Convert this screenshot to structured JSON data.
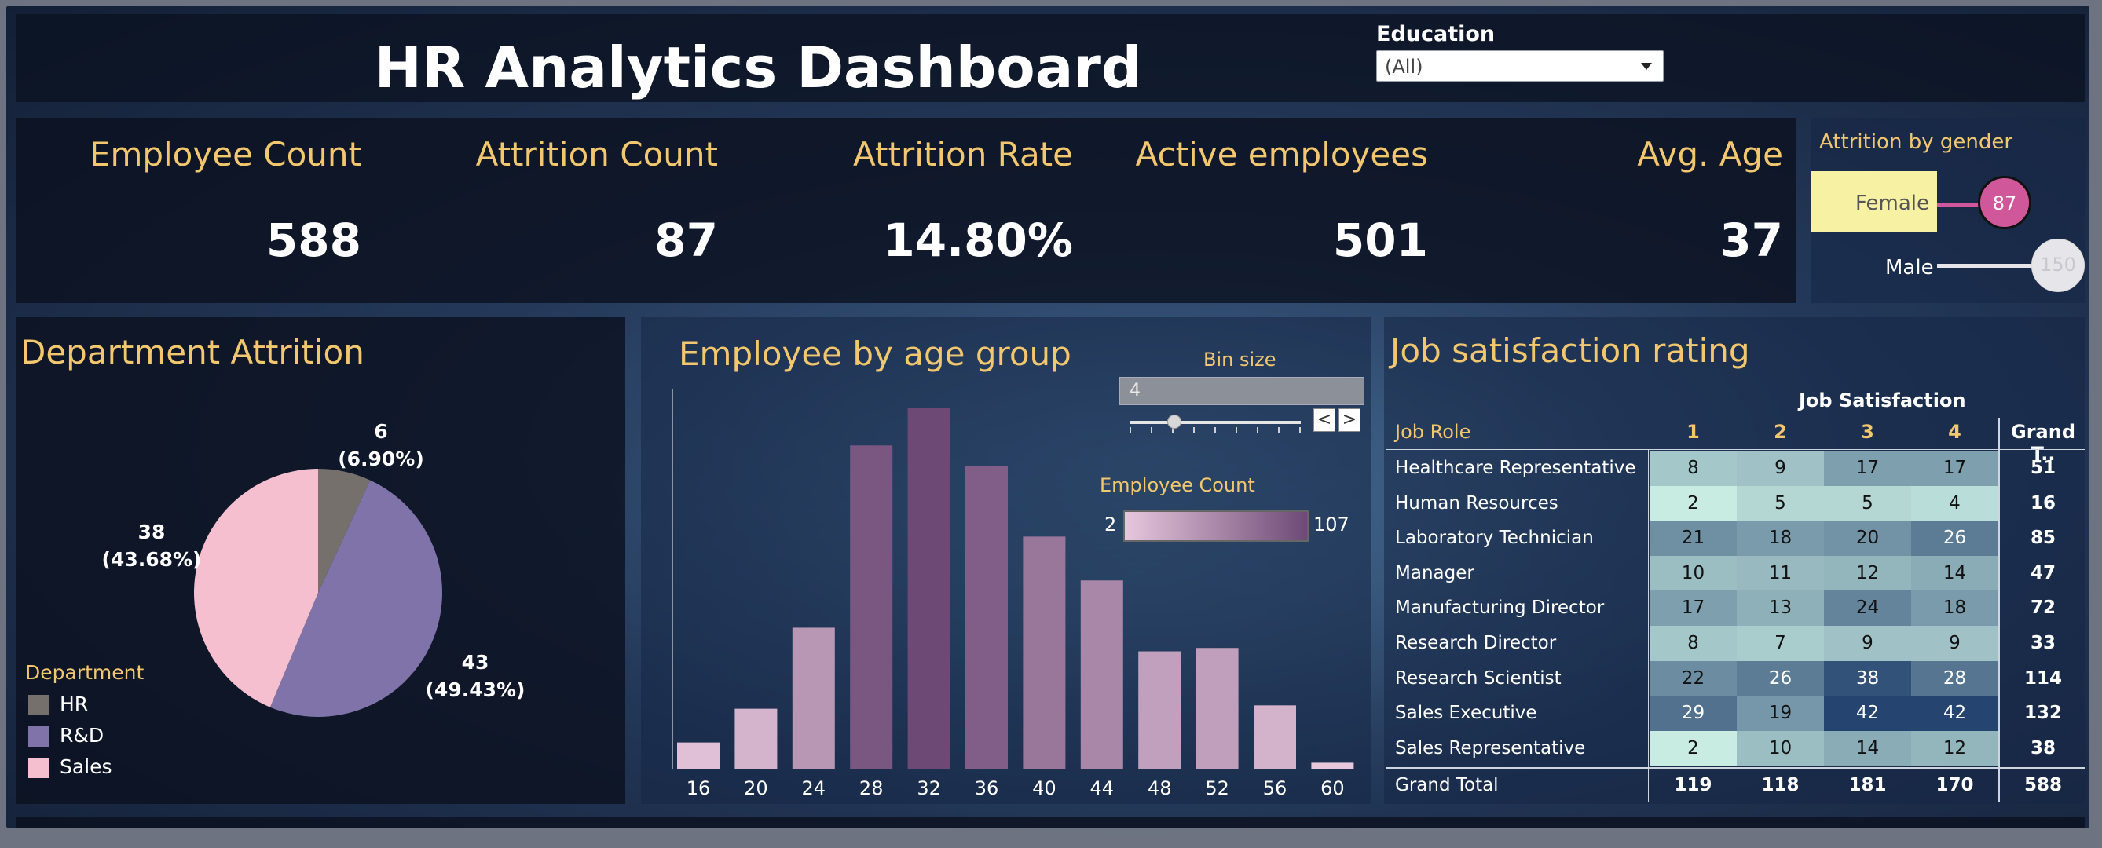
{
  "header": {
    "title": "HR Analytics Dashboard",
    "filter_label": "Education",
    "filter_value": "(All)"
  },
  "kpis": [
    {
      "label": "Employee Count",
      "value": "588"
    },
    {
      "label": "Attrition Count",
      "value": "87"
    },
    {
      "label": "Attrition Rate",
      "value": "14.80%"
    },
    {
      "label": "Active employees",
      "value": "501"
    },
    {
      "label": "Avg. Age",
      "value": "37"
    }
  ],
  "gender": {
    "title": "Attrition by gender",
    "female_label": "Female",
    "female_value": "87",
    "male_label": "Male",
    "male_value": "150",
    "female_color": "#d0589a",
    "male_color": "#e6e6ea"
  },
  "department": {
    "title": "Department Attrition",
    "legend_title": "Department",
    "legend": [
      {
        "name": "HR",
        "color": "#75706c"
      },
      {
        "name": "R&D",
        "color": "#7f73aa"
      },
      {
        "name": "Sales",
        "color": "#f5bfd0"
      }
    ],
    "labels": [
      {
        "count": "6",
        "pct": "(6.90%)"
      },
      {
        "count": "43",
        "pct": "(49.43%)"
      },
      {
        "count": "38",
        "pct": "(43.68%)"
      }
    ]
  },
  "age": {
    "title": "Employee by age group",
    "bin_label": "Bin size",
    "bin_value": "4",
    "bin_prev": "<",
    "bin_next": ">",
    "ec_label": "Employee Count",
    "ec_min": "2",
    "ec_max": "107"
  },
  "chart_data": [
    {
      "type": "pie",
      "title": "Department Attrition",
      "categories": [
        "HR",
        "R&D",
        "Sales"
      ],
      "values": [
        6,
        43,
        38
      ],
      "percent": [
        6.9,
        49.43,
        43.68
      ],
      "colors": [
        "#75706c",
        "#7f73aa",
        "#f5bfd0"
      ]
    },
    {
      "type": "bar",
      "title": "Employee by age group",
      "categories": [
        "16",
        "20",
        "24",
        "28",
        "32",
        "36",
        "40",
        "44",
        "48",
        "52",
        "56",
        "60"
      ],
      "values": [
        8,
        18,
        42,
        96,
        107,
        90,
        69,
        56,
        35,
        36,
        19,
        2
      ],
      "color_scale": {
        "min": 2,
        "max": 107,
        "min_color": "#e6c7dc",
        "max_color": "#6d4a76"
      }
    }
  ],
  "job": {
    "title": "Job satisfaction rating",
    "header_group": "Job Satisfaction",
    "row_header": "Job Role",
    "columns": [
      "1",
      "2",
      "3",
      "4"
    ],
    "total_header": "Grand T..",
    "rows": [
      {
        "role": "Healthcare Representative",
        "values": [
          "8",
          "9",
          "17",
          "17"
        ],
        "total": "51"
      },
      {
        "role": "Human Resources",
        "values": [
          "2",
          "5",
          "5",
          "4"
        ],
        "total": "16"
      },
      {
        "role": "Laboratory Technician",
        "values": [
          "21",
          "18",
          "20",
          "26"
        ],
        "total": "85"
      },
      {
        "role": "Manager",
        "values": [
          "10",
          "11",
          "12",
          "14"
        ],
        "total": "47"
      },
      {
        "role": "Manufacturing Director",
        "values": [
          "17",
          "13",
          "24",
          "18"
        ],
        "total": "72"
      },
      {
        "role": "Research Director",
        "values": [
          "8",
          "7",
          "9",
          "9"
        ],
        "total": "33"
      },
      {
        "role": "Research Scientist",
        "values": [
          "22",
          "26",
          "38",
          "28"
        ],
        "total": "114"
      },
      {
        "role": "Sales Executive",
        "values": [
          "29",
          "19",
          "42",
          "42"
        ],
        "total": "132"
      },
      {
        "role": "Sales Representative",
        "values": [
          "2",
          "10",
          "14",
          "12"
        ],
        "total": "38"
      }
    ],
    "grand_total_label": "Grand Total",
    "grand_totals": [
      "119",
      "118",
      "181",
      "170"
    ],
    "grand_total_all": "588"
  }
}
